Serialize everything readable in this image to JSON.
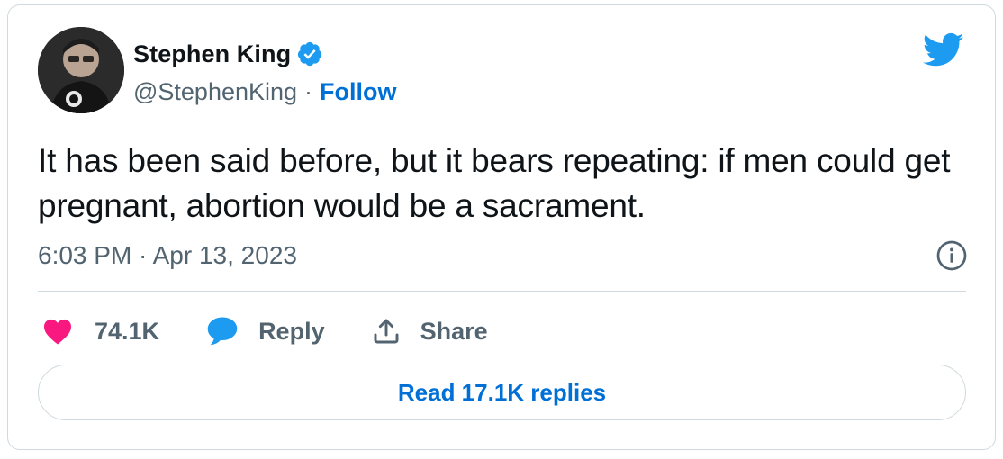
{
  "author": {
    "display_name": "Stephen King",
    "handle": "@StephenKing",
    "separator": "·",
    "follow_label": "Follow",
    "verified": true,
    "avatar_icon": "profile-photo"
  },
  "tweet": {
    "text": "It has been said before, but it bears repeating: if men could get pregnant, abortion would be a sacrament.",
    "timestamp": "6:03 PM · Apr 13, 2023"
  },
  "actions": {
    "like_count": "74.1K",
    "reply_label": "Reply",
    "share_label": "Share"
  },
  "read_replies_label": "Read 17.1K replies",
  "icons": {
    "brand": "twitter-bird-icon",
    "verified": "verified-badge-icon",
    "info": "info-icon",
    "like": "heart-icon",
    "reply": "speech-bubble-icon",
    "share": "share-upload-icon"
  },
  "colors": {
    "link_blue": "#006fd6",
    "twitter_blue": "#1d9bf0",
    "heart_pink": "#f91880",
    "muted_text": "#536471",
    "border": "#cfd9de",
    "text": "#0f1419"
  }
}
